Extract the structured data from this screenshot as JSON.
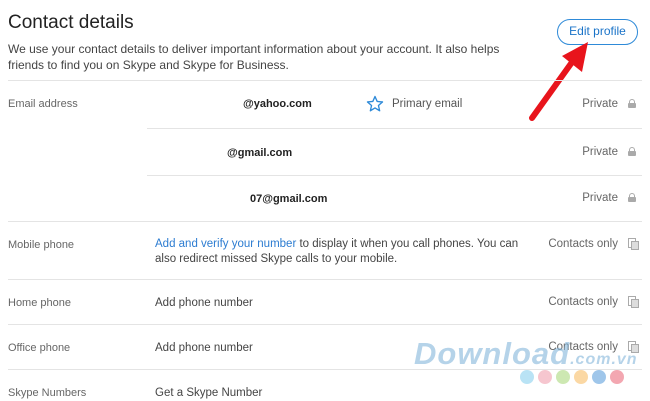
{
  "header": {
    "title": "Contact details",
    "description": "We use your contact details to deliver important information about your account. It also helps friends to find you on Skype and Skype for Business.",
    "edit_button": "Edit profile"
  },
  "email": {
    "label": "Email address",
    "entries": [
      {
        "address": "@yahoo.com",
        "primary_label": "Primary email",
        "privacy": "Private"
      },
      {
        "address": "@gmail.com",
        "privacy": "Private"
      },
      {
        "address": "07@gmail.com",
        "privacy": "Private"
      }
    ]
  },
  "mobile": {
    "label": "Mobile phone",
    "link": "Add and verify your number",
    "text_line1": " to display it when you call phones. You can",
    "text_line2": "also redirect missed Skype calls to your mobile.",
    "privacy": "Contacts only"
  },
  "home": {
    "label": "Home phone",
    "link": "Add phone number",
    "privacy": "Contacts only"
  },
  "office": {
    "label": "Office phone",
    "link": "Add phone number",
    "privacy": "Contacts only"
  },
  "skype_numbers": {
    "label": "Skype Numbers",
    "link": "Get a Skype Number"
  },
  "watermark": {
    "text": "Download",
    "suffix": ".com.vn"
  },
  "colors": {
    "accent": "#2c7cd1",
    "arrow": "#e8141c"
  }
}
